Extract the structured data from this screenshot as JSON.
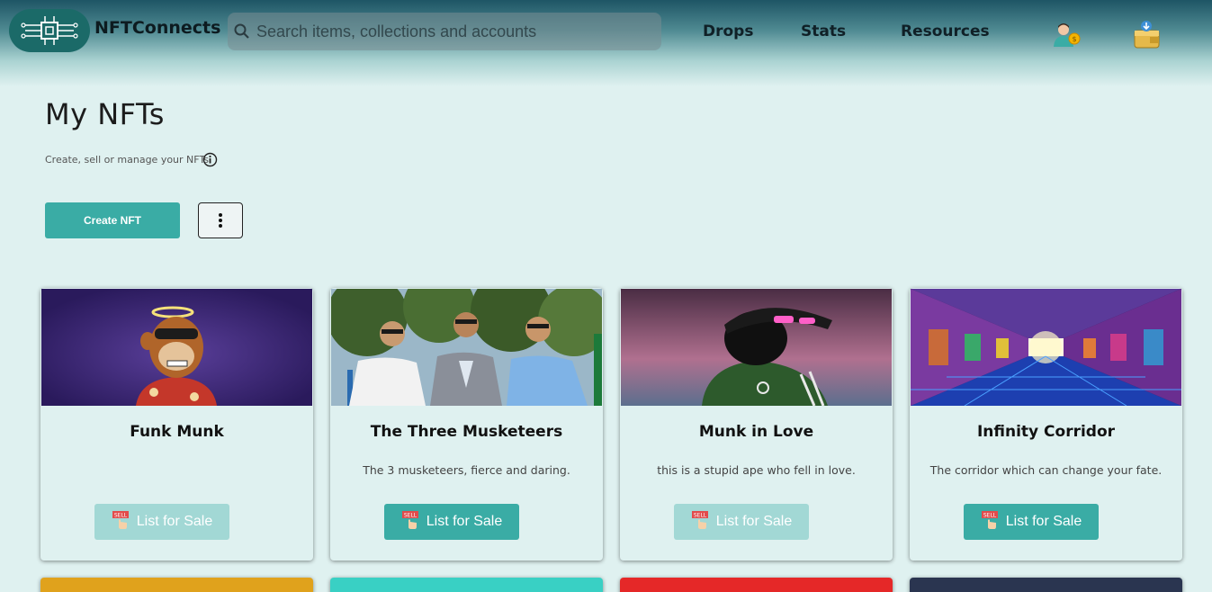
{
  "header": {
    "brand": "NFTConnects",
    "search_placeholder": "Search items, collections and accounts",
    "nav": [
      "Drops",
      "Stats",
      "Resources"
    ],
    "icons": [
      "profile-icon",
      "wallet-icon"
    ]
  },
  "page": {
    "title": "My NFTs",
    "subtitle": "Create, sell or manage your NFTs.",
    "create_label": "Create NFT"
  },
  "cards": [
    {
      "name": "Funk Munk",
      "description": "",
      "button": "List for Sale",
      "enabled": false
    },
    {
      "name": "The Three Musketeers",
      "description": "The 3 musketeers, fierce and daring.",
      "button": "List for Sale",
      "enabled": true
    },
    {
      "name": "Munk in Love",
      "description": "this is a stupid ape who fell in love.",
      "button": "List for Sale",
      "enabled": false
    },
    {
      "name": "Infinity Corridor",
      "description": "The corridor which can change your fate.",
      "button": "List for Sale",
      "enabled": true
    }
  ],
  "colors": {
    "accent": "#3aaca5",
    "accent_disabled": "#a2d8d5",
    "background": "#dff1f0"
  }
}
